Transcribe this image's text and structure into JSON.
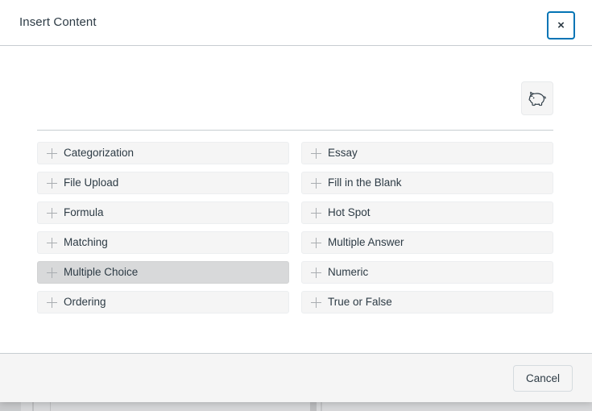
{
  "modal": {
    "title": "Insert Content",
    "close_label": "×",
    "close_icon": "close-icon",
    "focus_ring_color": "#0374b5"
  },
  "toolbar": {
    "piggy_icon": "piggy-bank-icon",
    "piggy_tooltip": "Piggy Bank"
  },
  "question_types": {
    "plus_icon": "plus-icon",
    "hovered": "Multiple Choice",
    "left_column": [
      {
        "label": "Categorization",
        "hovered": false
      },
      {
        "label": "File Upload",
        "hovered": false
      },
      {
        "label": "Formula",
        "hovered": false
      },
      {
        "label": "Matching",
        "hovered": false
      },
      {
        "label": "Multiple Choice",
        "hovered": true
      },
      {
        "label": "Ordering",
        "hovered": false
      }
    ],
    "right_column": [
      {
        "label": "Essay",
        "hovered": false
      },
      {
        "label": "Fill in the Blank",
        "hovered": false
      },
      {
        "label": "Hot Spot",
        "hovered": false
      },
      {
        "label": "Multiple Answer",
        "hovered": false
      },
      {
        "label": "Numeric",
        "hovered": false
      },
      {
        "label": "True or False",
        "hovered": false
      }
    ]
  },
  "footer": {
    "cancel_label": "Cancel"
  },
  "colors": {
    "accent_blue": "#0374b5",
    "text": "#2d3b45",
    "button_bg": "#f5f5f5",
    "button_hover_bg": "#d8d9da",
    "divider": "#c7cdd1"
  }
}
